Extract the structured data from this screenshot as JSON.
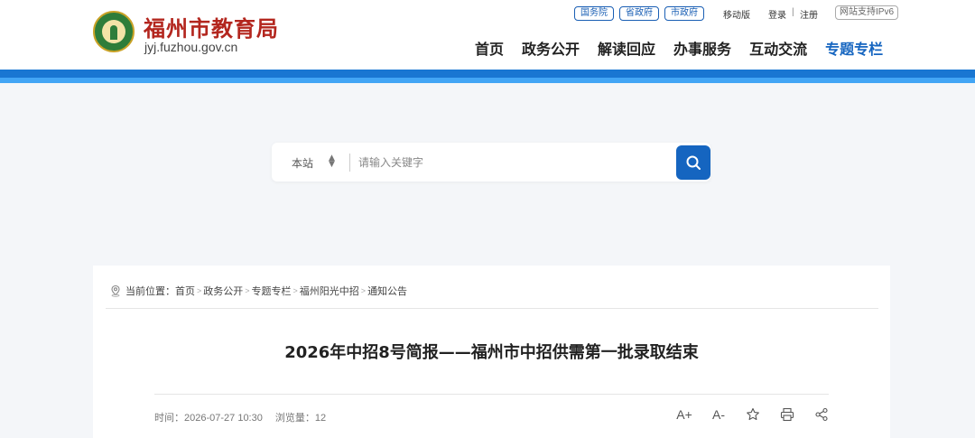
{
  "site": {
    "title": "福州市教育局",
    "domain": "jyj.fuzhou.gov.cn"
  },
  "top_links": {
    "gov": [
      "国务院",
      "省政府",
      "市政府"
    ],
    "mobile": "移动版",
    "login": "登录",
    "separator": "|",
    "register": "注册",
    "ipv6": "网站支持IPv6"
  },
  "nav": {
    "items": [
      "首页",
      "政务公开",
      "解读回应",
      "办事服务",
      "互动交流",
      "专题专栏"
    ],
    "active_index": 5
  },
  "search": {
    "scope": "本站",
    "placeholder": "请输入关键字",
    "button_icon": "search-icon"
  },
  "breadcrumb": {
    "prefix": "当前位置：",
    "items": [
      "首页",
      "政务公开",
      "专题专栏",
      "福州阳光中招",
      "通知公告"
    ]
  },
  "article": {
    "title": "2026年中招8号简报——福州市中招供需第一批录取结束",
    "time_label": "时间：",
    "time": "2026-07-27 10:30",
    "views_label": "浏览量：",
    "views": "12"
  },
  "tools": {
    "font_increase": "A+",
    "font_decrease": "A-",
    "favorite_icon": "star-icon",
    "print_icon": "print-icon",
    "share_icon": "share-icon"
  },
  "colors": {
    "brand_red": "#b3261e",
    "nav_active": "#1565c0",
    "header_bar": "#1976d2"
  }
}
